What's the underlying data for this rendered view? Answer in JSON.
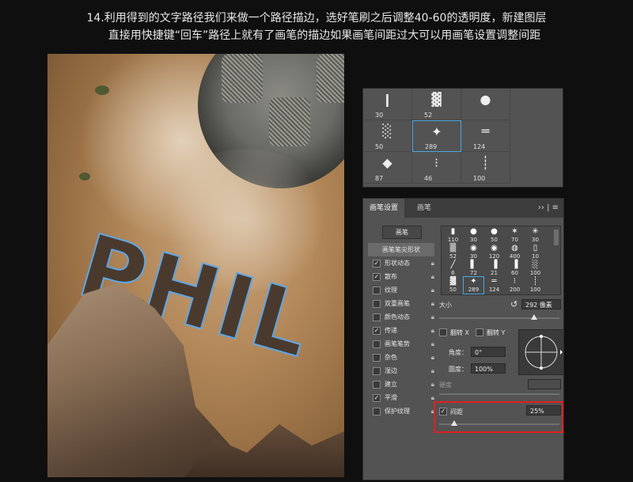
{
  "caption": {
    "line1": "14.利用得到的文字路径我们来做一个路径描边，选好笔刷之后调整40-60的透明度，新建图层",
    "line2": "直接用快捷键“回车”路径上就有了画笔的描边如果画笔间距过大可以用画笔设置调整间距"
  },
  "photo": {
    "text": "PHIL"
  },
  "presets": [
    {
      "size": "30",
      "icon": "brush-stroke-icon"
    },
    {
      "size": "52",
      "icon": "brush-texture-icon"
    },
    {
      "size": "",
      "icon": "soft-round-icon"
    },
    {
      "size": "50",
      "icon": "brush-speckle-icon"
    },
    {
      "size": "289",
      "icon": "scatter-leaves-icon",
      "selected": true
    },
    {
      "size": "124",
      "icon": "brush-dash-icon"
    },
    {
      "size": "87",
      "icon": "brush-chips-icon"
    },
    {
      "size": "46",
      "icon": "brush-dots-icon"
    },
    {
      "size": "100",
      "icon": "brush-dotted-line-icon"
    }
  ],
  "brush_settings": {
    "tabs": [
      "画笔设置",
      "画笔"
    ],
    "menu": "›› | ≡",
    "brush_button": "画笔",
    "options_header": "画笔笔尖形状",
    "options": [
      {
        "label": "形状动态",
        "checked": true
      },
      {
        "label": "散布",
        "checked": true
      },
      {
        "label": "纹理",
        "checked": false
      },
      {
        "label": "双重画笔",
        "checked": false
      },
      {
        "label": "颜色动态",
        "checked": false
      },
      {
        "label": "传递",
        "checked": true
      },
      {
        "label": "画笔笔势",
        "checked": false
      },
      {
        "label": "杂色",
        "checked": false
      },
      {
        "label": "湿边",
        "checked": false
      },
      {
        "label": "建立",
        "checked": false
      },
      {
        "label": "平滑",
        "checked": true
      },
      {
        "label": "保护纹理",
        "checked": false
      }
    ],
    "tips_row1": [
      "110",
      "30",
      "50",
      "70",
      "30"
    ],
    "tips_row2": [
      "52",
      "30",
      "120",
      "400",
      "10"
    ],
    "tips_row3": [
      "6",
      "72",
      "21",
      "60",
      "100"
    ],
    "tips_row4": [
      "50",
      "289",
      "124",
      "200",
      "100"
    ],
    "size_label": "大小",
    "size_value": "292 像素",
    "flip_x": "翻转 X",
    "flip_y": "翻转 Y",
    "angle_label": "角度：",
    "angle_value": "0°",
    "roundness_label": "圆度：",
    "roundness_value": "100%",
    "hardness_label": "硬度",
    "spacing_label": "间距",
    "spacing_value": "25%"
  },
  "colors": {
    "highlight": "#e02020",
    "selection": "#48a7e0"
  }
}
